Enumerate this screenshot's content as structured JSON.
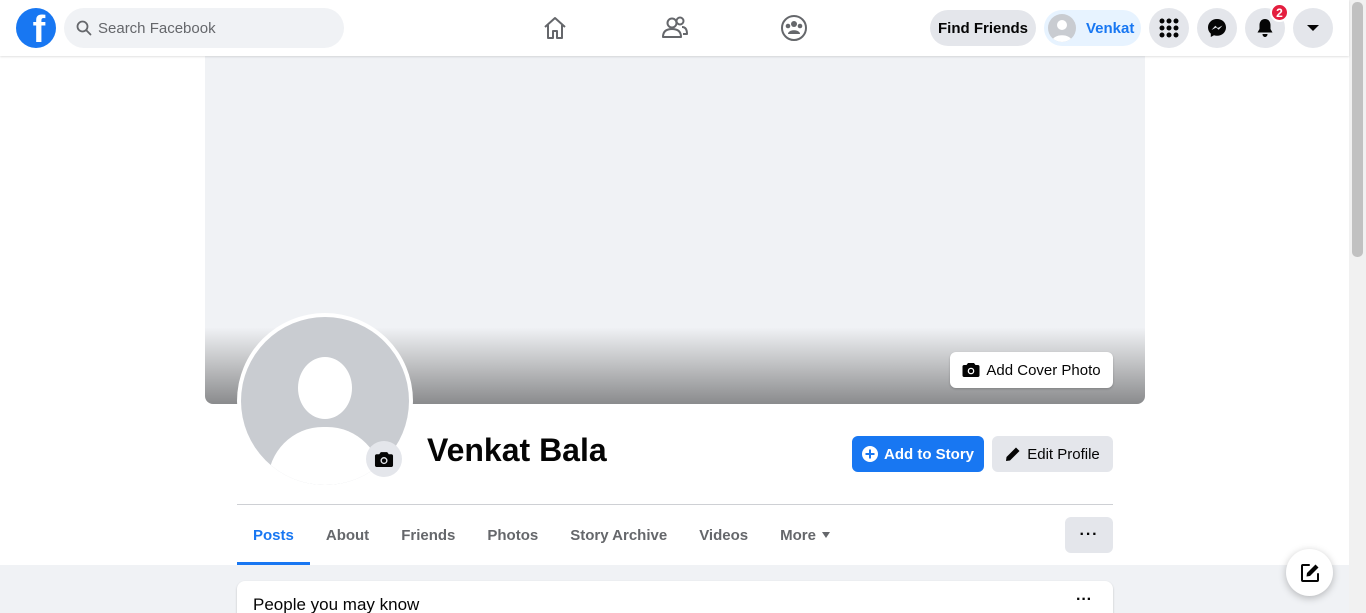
{
  "header": {
    "search_placeholder": "Search Facebook",
    "find_friends_label": "Find Friends",
    "profile_chip_name": "Venkat",
    "notifications_count": "2",
    "brand_color": "#1877f2"
  },
  "cover": {
    "add_cover_label": "Add Cover Photo"
  },
  "profile": {
    "name": "Venkat Bala",
    "add_story_label": "Add to Story",
    "edit_profile_label": "Edit Profile"
  },
  "tabs": [
    {
      "label": "Posts",
      "active": true
    },
    {
      "label": "About"
    },
    {
      "label": "Friends"
    },
    {
      "label": "Photos"
    },
    {
      "label": "Story Archive"
    },
    {
      "label": "Videos"
    },
    {
      "label": "More"
    }
  ],
  "tab_overflow_label": "···",
  "feed": {
    "pymk_title": "People you may know",
    "pymk_more": "···"
  },
  "icons": [
    "facebook-logo-icon",
    "search-icon",
    "home-icon",
    "friends-icon",
    "groups-icon",
    "menu-grid-icon",
    "messenger-icon",
    "bell-icon",
    "caret-down-icon",
    "camera-icon",
    "plus-circle-icon",
    "pencil-icon",
    "compose-icon"
  ]
}
